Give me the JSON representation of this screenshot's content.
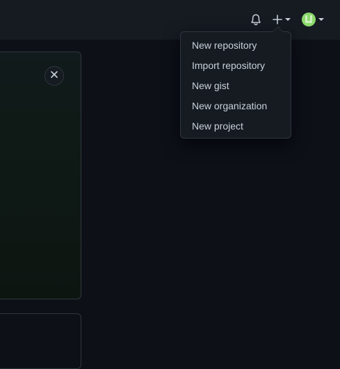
{
  "header": {
    "icons": [
      "bell-icon",
      "plus-icon",
      "avatar"
    ]
  },
  "create_menu": {
    "items": [
      {
        "label": "New repository"
      },
      {
        "label": "Import repository"
      },
      {
        "label": "New gist"
      },
      {
        "label": "New organization"
      },
      {
        "label": "New project"
      }
    ]
  },
  "colors": {
    "background": "#0d1117",
    "header": "#161b22",
    "border": "#30363d",
    "text": "#c9d1d9",
    "avatar": "#8bd96b"
  }
}
